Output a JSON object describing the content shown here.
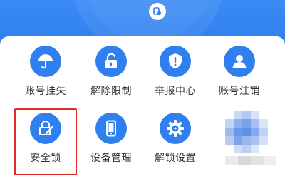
{
  "colors": {
    "brand_blue": "#2f7fee",
    "highlight_red": "#e02b2b",
    "label_text": "#333333"
  },
  "header": {
    "badge_icon": "shield-lock-icon"
  },
  "grid": {
    "items": [
      {
        "label": "账号挂失",
        "icon": "umbrella-icon"
      },
      {
        "label": "解除限制",
        "icon": "unlock-icon"
      },
      {
        "label": "举报中心",
        "icon": "alert-shield-icon"
      },
      {
        "label": "账号注销",
        "icon": "user-icon"
      },
      {
        "label": "安全锁",
        "icon": "security-lock-icon",
        "highlighted": true
      },
      {
        "label": "设备管理",
        "icon": "phone-icon"
      },
      {
        "label": "解锁设置",
        "icon": "gear-icon"
      },
      {
        "label": "",
        "icon": "blurred-icon"
      }
    ]
  }
}
